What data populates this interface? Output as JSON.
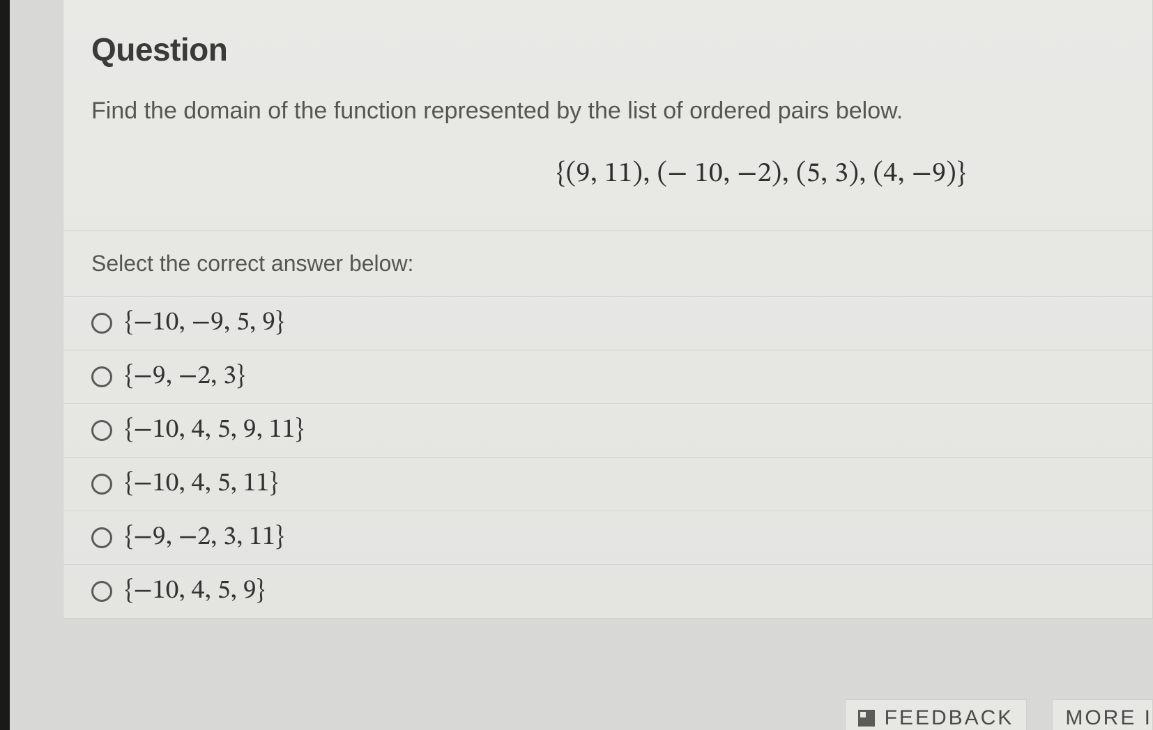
{
  "question": {
    "title": "Question",
    "prompt": "Find the domain of the function represented by the list of ordered pairs below.",
    "formula": "{(9, 11), (− 10, −2), (5, 3), (4, −9)}",
    "instruction": "Select the correct answer below:",
    "options": [
      "{−10, −9, 5, 9}",
      "{−9, −2, 3}",
      "{−10, 4, 5, 9, 11}",
      "{−10, 4, 5, 11}",
      "{−9, −2, 3, 11}",
      "{−10, 4, 5, 9}"
    ]
  },
  "footer": {
    "feedback": "FEEDBACK",
    "more": "MORE I"
  }
}
